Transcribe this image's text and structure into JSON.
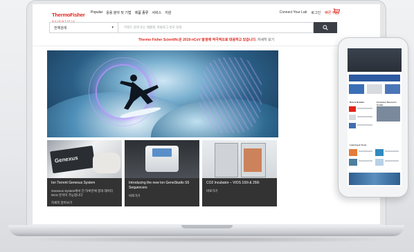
{
  "header": {
    "logo_main": "ThermoFisher",
    "logo_sub": "SCIENTIFIC",
    "nav": [
      "Popular",
      "응용 분야 및 기법",
      "제품 종류",
      "서비스",
      "지원"
    ],
    "connect": "Connect Your Lab",
    "login": "로그인",
    "quick_order": "빠른 주문"
  },
  "search": {
    "scope": "전체검색",
    "placeholder": "키워드 검색 또는 제품명, 카탈로그 번호 검색",
    "button_icon": "search-icon"
  },
  "notice": {
    "text": "Thermo Fisher Scientific은 2019-nCoV 발생에 적극적으로 대응하고 있습니다.",
    "link": "자세히 보기"
  },
  "cards": [
    {
      "title": "Ion Torrent Genexus System",
      "desc": "Genexus System에서 단 하루만에 결과 데이터 NGS 분석이 가능합니다",
      "more": "자세히 알아보기",
      "image_text": "Genexus"
    },
    {
      "title": "Introducing the new Ion GeneStudio S5 Sequencers",
      "more": "바로가기"
    },
    {
      "title": "CO2 Incubator – VIOS 160i & 250i",
      "more": "바로가기"
    }
  ],
  "phone": {
    "section1": "New & Notable",
    "section2": "Customer Resource Center",
    "section3": "Learning & Tools"
  },
  "colors": {
    "brand_red": "#e1251b",
    "search_button": "#3b3f45",
    "card_bg": "#333333"
  }
}
